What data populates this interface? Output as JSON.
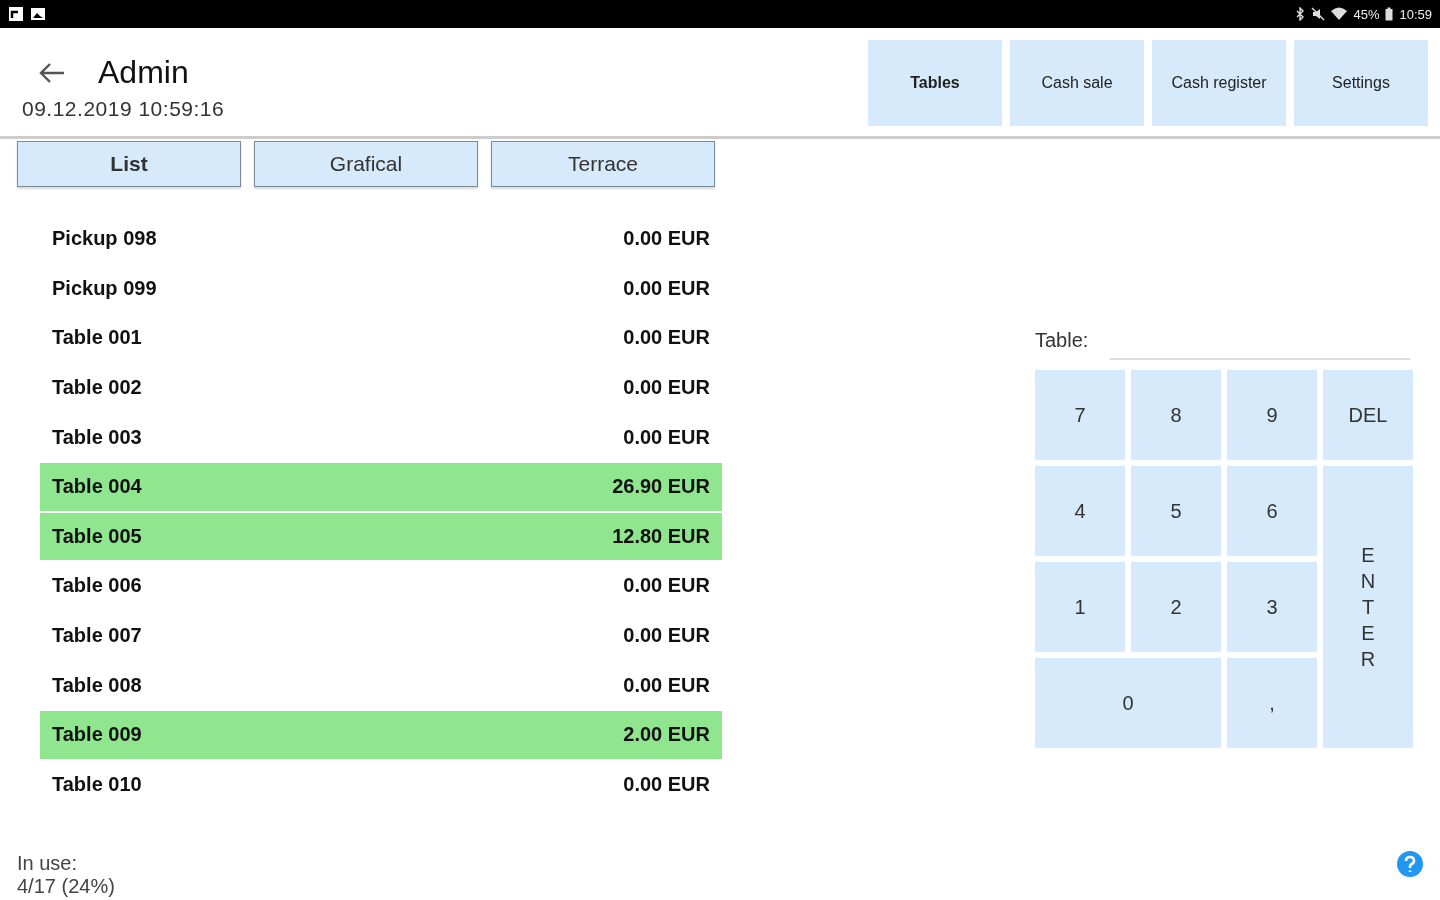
{
  "status_bar": {
    "battery": "45%",
    "time": "10:59"
  },
  "header": {
    "title": "Admin",
    "datetime": "09.12.2019 10:59:16"
  },
  "nav": [
    {
      "label": "Tables",
      "selected": true
    },
    {
      "label": "Cash sale",
      "selected": false
    },
    {
      "label": "Cash register",
      "selected": false
    },
    {
      "label": "Settings",
      "selected": false
    }
  ],
  "view_tabs": [
    {
      "label": "List",
      "selected": true
    },
    {
      "label": "Grafical",
      "selected": false
    },
    {
      "label": "Terrace",
      "selected": false
    }
  ],
  "tables": [
    {
      "name": "Pickup 098",
      "amount": "0.00 EUR",
      "occupied": false
    },
    {
      "name": "Pickup 099",
      "amount": "0.00 EUR",
      "occupied": false
    },
    {
      "name": "Table 001",
      "amount": "0.00 EUR",
      "occupied": false
    },
    {
      "name": "Table 002",
      "amount": "0.00 EUR",
      "occupied": false
    },
    {
      "name": "Table 003",
      "amount": "0.00 EUR",
      "occupied": false
    },
    {
      "name": "Table 004",
      "amount": "26.90 EUR",
      "occupied": true
    },
    {
      "name": "Table 005",
      "amount": "12.80 EUR",
      "occupied": true
    },
    {
      "name": "Table 006",
      "amount": "0.00 EUR",
      "occupied": false
    },
    {
      "name": "Table 007",
      "amount": "0.00 EUR",
      "occupied": false
    },
    {
      "name": "Table 008",
      "amount": "0.00 EUR",
      "occupied": false
    },
    {
      "name": "Table 009",
      "amount": "2.00 EUR",
      "occupied": true
    },
    {
      "name": "Table 010",
      "amount": "0.00 EUR",
      "occupied": false
    }
  ],
  "keypad": {
    "field_label": "Table:",
    "keys": [
      {
        "label": "7",
        "kind": "normal"
      },
      {
        "label": "8",
        "kind": "normal"
      },
      {
        "label": "9",
        "kind": "normal"
      },
      {
        "label": "DEL",
        "kind": "normal"
      },
      {
        "label": "4",
        "kind": "normal"
      },
      {
        "label": "5",
        "kind": "normal"
      },
      {
        "label": "6",
        "kind": "normal"
      },
      {
        "label": "1",
        "kind": "normal"
      },
      {
        "label": "2",
        "kind": "normal"
      },
      {
        "label": "3",
        "kind": "normal"
      },
      {
        "label": "0",
        "kind": "wide"
      },
      {
        "label": ",",
        "kind": "normal"
      },
      {
        "label": "ENTER",
        "kind": "tall"
      }
    ]
  },
  "footer": {
    "label": "In use:",
    "value": "4/17 (24%)"
  }
}
